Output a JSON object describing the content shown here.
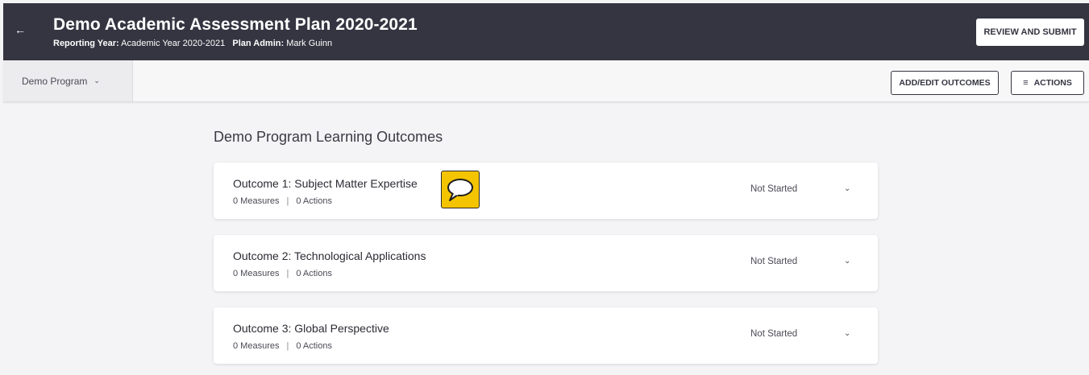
{
  "header": {
    "back_icon": "arrow-left-icon",
    "title": "Demo Academic Assessment Plan 2020-2021",
    "reporting_year_label": "Reporting Year:",
    "reporting_year_value": "Academic Year 2020-2021",
    "plan_admin_label": "Plan Admin:",
    "plan_admin_value": "Mark Guinn",
    "review_submit_label": "REVIEW AND SUBMIT"
  },
  "toolbar": {
    "program_selected": "Demo Program",
    "program_chevron_icon": "chevron-down-icon",
    "add_edit_outcomes_label": "ADD/EDIT OUTCOMES",
    "actions_icon": "menu-icon",
    "actions_label": "ACTIONS"
  },
  "main": {
    "section_title": "Demo Program Learning Outcomes",
    "outcomes": [
      {
        "title": "Outcome 1: Subject Matter Expertise",
        "measures": "0 Measures",
        "separator": "|",
        "actions": "0 Actions",
        "status": "Not Started"
      },
      {
        "title": "Outcome 2: Technological Applications",
        "measures": "0 Measures",
        "separator": "|",
        "actions": "0 Actions",
        "status": "Not Started"
      },
      {
        "title": "Outcome 3: Global Perspective",
        "measures": "0 Measures",
        "separator": "|",
        "actions": "0 Actions",
        "status": "Not Started"
      }
    ],
    "comment_icon": "speech-bubble-icon"
  },
  "colors": {
    "header_bg": "#343541",
    "comment_badge": "#f5c400"
  }
}
